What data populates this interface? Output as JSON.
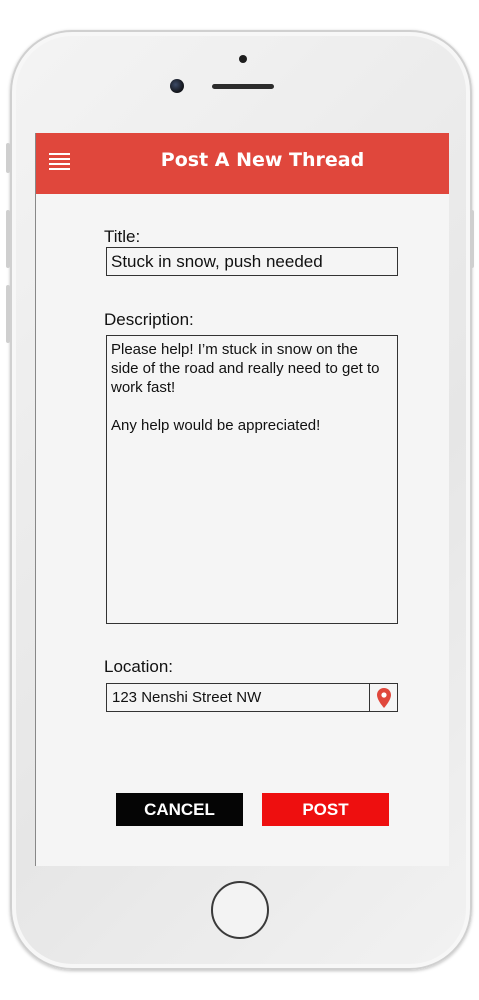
{
  "header": {
    "title": "Post A New Thread",
    "menu_icon": "hamburger-menu-icon",
    "color": "#e0473c"
  },
  "form": {
    "title_label": "Title:",
    "title_value": "Stuck in snow, push needed",
    "description_label": "Description:",
    "description_lines": [
      "Please help! I’m stuck in snow on the",
      "side of the road and really need to get to",
      "work fast!",
      "",
      "Any help would be appreciated!"
    ],
    "location_label": "Location:",
    "location_value": "123 Nenshi Street NW",
    "location_icon": "map-pin-icon"
  },
  "actions": {
    "cancel_label": "CANCEL",
    "post_label": "POST",
    "cancel_color": "#050505",
    "post_color": "#ee0f0f"
  }
}
